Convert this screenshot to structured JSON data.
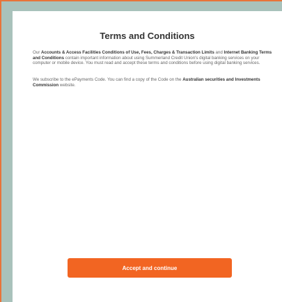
{
  "terms": {
    "title": "Terms and Conditions",
    "p1_pre": "Our ",
    "p1_link1": "Accounts & Access Facilities Conditions of Use, Fees, Charges & Transaction Limits",
    "p1_mid": " and ",
    "p1_link2": "Internet Banking Terms and Conditions",
    "p1_post": " contain important information about using Summerland Credit Union's digital banking services on your computer or mobile device. You must read and accept these terms and conditions before using digital banking services.",
    "p2_pre": "We subscribe to the ePayments Code. You can find a copy of the Code on the ",
    "p2_link": "Australian securities and Investments Commission",
    "p2_post": " website.",
    "accept_label": "Accept and continue"
  },
  "colors": {
    "accent": "#f26522",
    "frame_border": "#e8743a",
    "background_band": "#a9c2bb"
  }
}
